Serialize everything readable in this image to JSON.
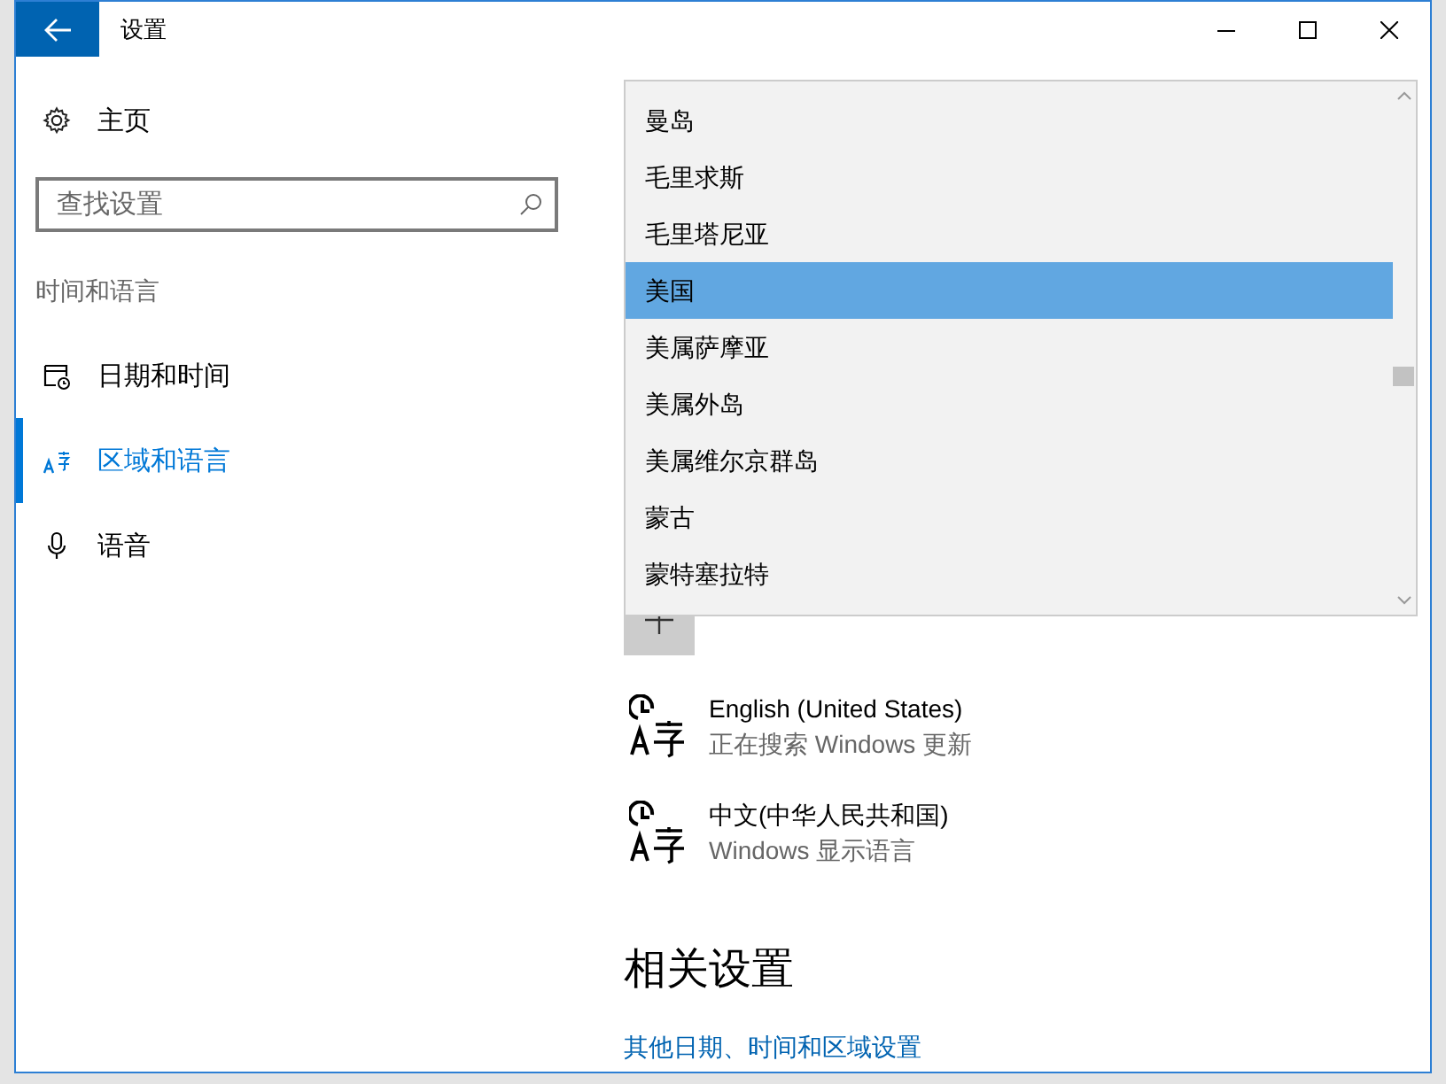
{
  "window": {
    "title": "设置"
  },
  "sidebar": {
    "home": "主页",
    "search": {
      "placeholder": "查找设置"
    },
    "section": "时间和语言",
    "items": [
      {
        "label": "日期和时间",
        "kind": "calendar",
        "selected": false
      },
      {
        "label": "区域和语言",
        "kind": "language",
        "selected": true
      },
      {
        "label": "语音",
        "kind": "microphone",
        "selected": false
      }
    ]
  },
  "dropdown": {
    "items": [
      {
        "label": "曼岛",
        "selected": false
      },
      {
        "label": "毛里求斯",
        "selected": false
      },
      {
        "label": "毛里塔尼亚",
        "selected": false
      },
      {
        "label": "美国",
        "selected": true
      },
      {
        "label": "美属萨摩亚",
        "selected": false
      },
      {
        "label": "美属外岛",
        "selected": false
      },
      {
        "label": "美属维尔京群岛",
        "selected": false
      },
      {
        "label": "蒙古",
        "selected": false
      },
      {
        "label": "蒙特塞拉特",
        "selected": false
      }
    ]
  },
  "languages": [
    {
      "name": "English (United States)",
      "status": "正在搜索 Windows 更新"
    },
    {
      "name": "中文(中华人民共和国)",
      "status": "Windows 显示语言"
    }
  ],
  "related": {
    "heading": "相关设置",
    "links": [
      "其他日期、时间和区域设置"
    ]
  }
}
